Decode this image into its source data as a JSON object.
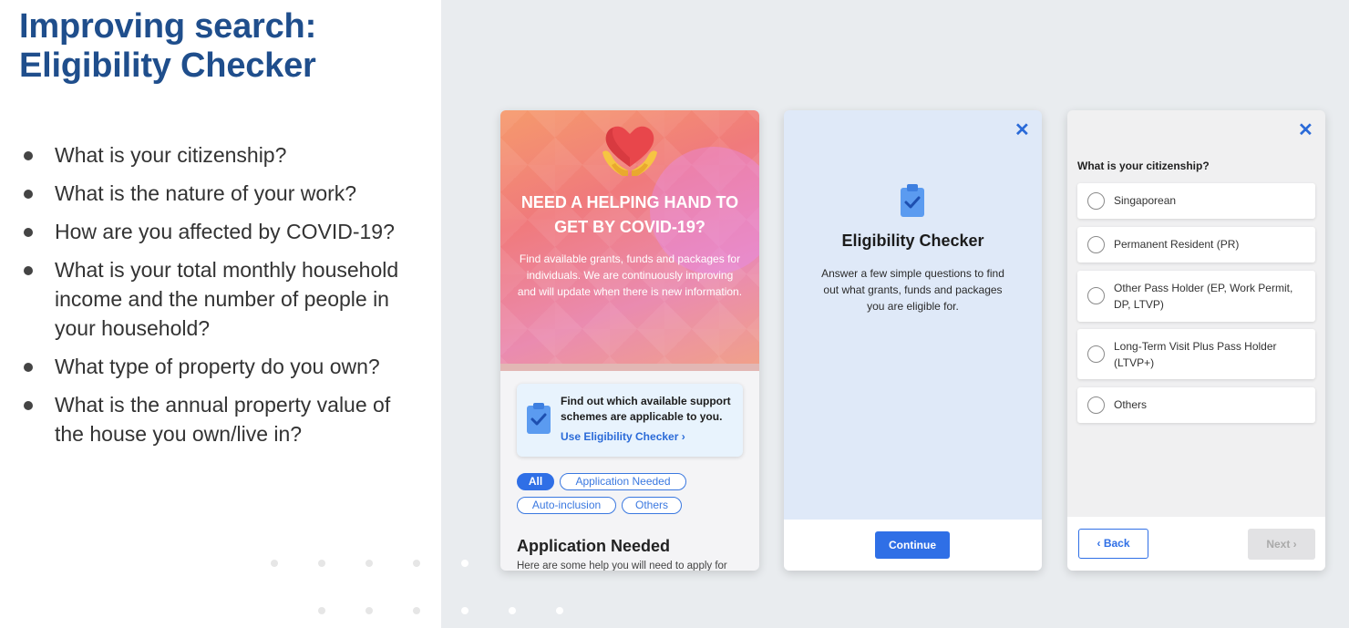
{
  "slide": {
    "title_line1": "Improving search:",
    "title_line2": "Eligibility Checker",
    "questions": [
      "What is your citizenship?",
      "What is the nature of your work?",
      "How are you affected by COVID-19?",
      "What is your total monthly household income and the number of people in your household?",
      "What type of property do you own?",
      "What is the annual property value of the house you own/live in?"
    ]
  },
  "screen1": {
    "hero_title": "NEED A HELPING HAND TO GET BY COVID-19?",
    "hero_text": "Find available grants, funds and packages for individuals. We are continuously improving and will update when there is new information.",
    "card_text": "Find out which available support schemes are applicable to you.",
    "card_link": "Use Eligibility Checker",
    "card_link_chevron": "›",
    "chips": [
      "All",
      "Application Needed",
      "Auto-inclusion",
      "Others"
    ],
    "section_title": "Application Needed",
    "section_sub": "Here are some help you will need to apply for"
  },
  "screen2": {
    "close_icon": "✕",
    "title": "Eligibility Checker",
    "description": "Answer a few simple questions to find out what grants, funds and packages you are eligible for.",
    "continue_label": "Continue"
  },
  "screen3": {
    "close_icon": "✕",
    "question": "What is your citizenship?",
    "options": [
      "Singaporean",
      "Permanent Resident (PR)",
      "Other Pass Holder (EP, Work Permit, DP, LTVP)",
      "Long-Term Visit Plus Pass Holder (LTVP+)",
      "Others"
    ],
    "back_label": "Back",
    "next_label": "Next",
    "back_chevron": "‹",
    "next_chevron": "›"
  },
  "colors": {
    "title": "#1f4e8c",
    "accent": "#2f6fe6",
    "panel_bg": "#e9ecef"
  }
}
